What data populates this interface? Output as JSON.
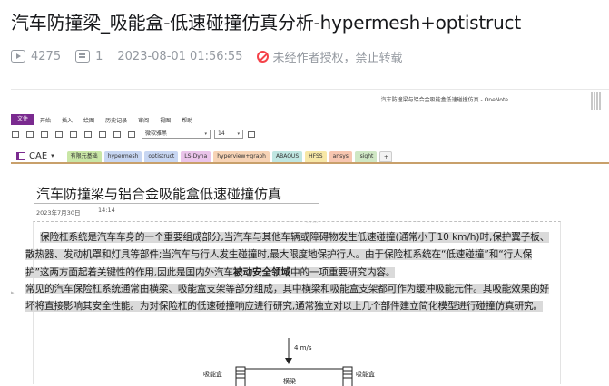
{
  "video": {
    "title": "汽车防撞梁_吸能盒-低速碰撞仿真分析-hypermesh+optistruct",
    "views": "4275",
    "danmaku": "1",
    "datetime": "2023-08-01 01:56:55",
    "copyright": "未经作者授权，禁止转载",
    "icons": [
      "play-count-icon",
      "danmaku-icon",
      "no-repost-icon"
    ],
    "colors": {
      "warning": "#f5434a",
      "meta": "#9499a0"
    }
  },
  "onenote": {
    "window_title": "汽车防撞梁与铝合金吸能盒低速碰撞仿真 - OneNote",
    "menu": {
      "file": "文件",
      "items": [
        "开始",
        "插入",
        "绘图",
        "历史记录",
        "审阅",
        "视图",
        "帮助"
      ]
    },
    "toolbar": {
      "font": "微软雅黑",
      "font_size": "14"
    },
    "notebook": "CAE",
    "section_tabs": [
      {
        "label": "有限元基础",
        "color": "#c9e6a6"
      },
      {
        "label": "hypermesh",
        "color": "#c7d6f2"
      },
      {
        "label": "optistruct",
        "color": "#c7d6f2"
      },
      {
        "label": "LS-Dyna",
        "color": "#eac4ea"
      },
      {
        "label": "hyperview+graph",
        "color": "#f7d3b5"
      },
      {
        "label": "ABAQUS",
        "color": "#bfe6e1"
      },
      {
        "label": "HFSS",
        "color": "#f7e7a6"
      },
      {
        "label": "ansys",
        "color": "#f7c6b0"
      },
      {
        "label": "lsight",
        "color": "#cfe7c4"
      },
      {
        "label": "+",
        "color": "#f2f2f2"
      }
    ],
    "page": {
      "title": "汽车防撞梁与铝合金吸能盒低速碰撞仿真",
      "date": "2023年7月30日",
      "time": "14:14",
      "p1_a": "保险杠系统是汽车车身的一个重要组成部分,当汽车与其他车辆或障碍物发生低速碰撞(通常小于10 km/h)时,保护翼子板、散热器、发动机罩和灯具等部件;当汽车与行人发生碰撞时,最大限度地保护行人。由于保险杠系统在“低速碰撞”和“行人保护”这两方面起着关键性的作用,因此是国内外汽车",
      "p1_bold": "被动安全领域",
      "p1_b": "中的一项重要研究内容。",
      "p2": "常见的汽车保险杠系统通常由横梁、吸能盒支架等部分组成，其中横梁和吸能盒支架都可作为缓冲吸能元件。其吸能效果的好坏将直接影响其安全性能。为对保险杠的低速碰撞响应进行研究,通常独立对以上几个部件建立简化模型进行碰撞仿真研究。",
      "diagram": {
        "speed": "4 m/s",
        "left_label": "吸能盒",
        "right_label": "吸能盒",
        "beam_label": "横梁"
      }
    }
  }
}
